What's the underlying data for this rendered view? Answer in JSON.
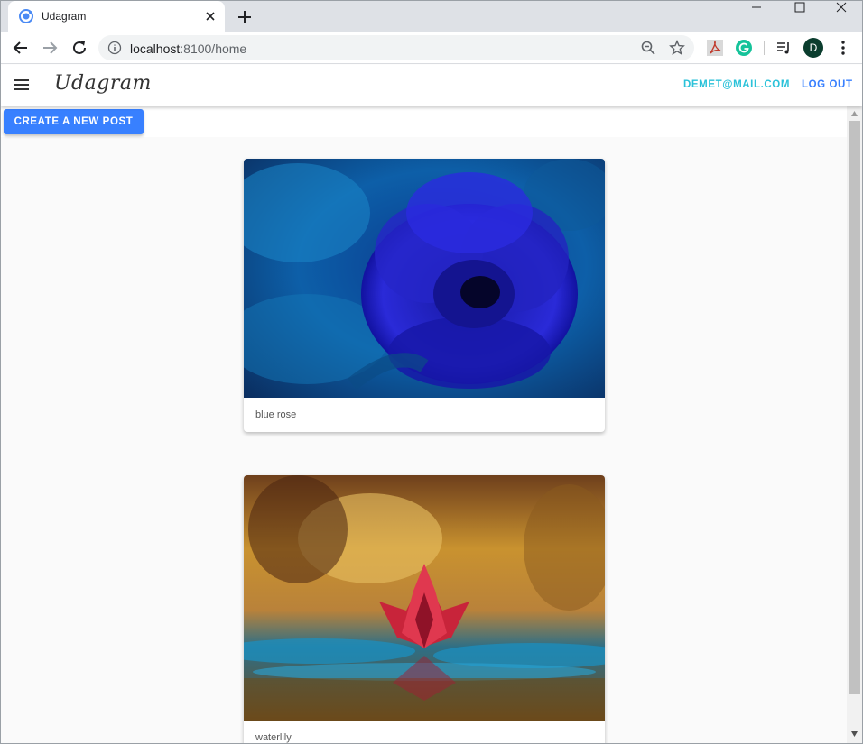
{
  "browser": {
    "tab_title": "Udagram",
    "url_host": "localhost",
    "url_rest": ":8100/home",
    "profile_initial": "D",
    "icons": [
      "favicon-icon",
      "close-icon",
      "plus-icon",
      "back-icon",
      "forward-icon",
      "reload-icon",
      "info-icon",
      "zoom-icon",
      "star-icon",
      "pdf-extension-icon",
      "grammarly-icon",
      "media-control-icon",
      "kebab-menu-icon"
    ]
  },
  "app": {
    "brand": "Udagram",
    "nav": {
      "email": "DEMET@MAIL.COM",
      "logout": "LOG OUT"
    },
    "create_button": "CREATE A NEW POST",
    "accent": "#3880ff",
    "secondary": "#2bc2d9"
  },
  "posts": [
    {
      "caption": "blue rose",
      "image": "blue rose photo"
    },
    {
      "caption": "waterlily",
      "image": "red waterlily photo"
    }
  ]
}
